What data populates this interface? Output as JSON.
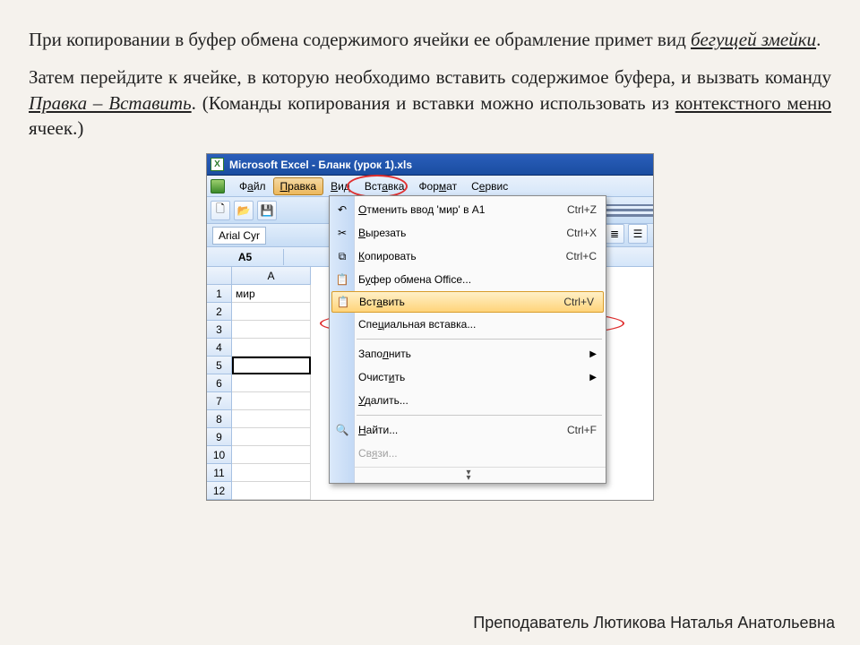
{
  "para1_head": "При копировании в буфер обмена содержимого ячейки ее обрамление примет вид ",
  "para1_u_i": "бегущей змейки",
  "para1_tail": ".",
  "para2_a": "Затем перейдите к ячейке, в которую необходимо вставить содержимое буфера, и вызвать команду ",
  "para2_i_u": "Правка – Вставить",
  "para2_b": ". (Команды копирования и вставки можно использовать из ",
  "para2_u2": "контекстного меню",
  "para2_c": " ячеек.)",
  "footer": "Преподаватель Лютикова Наталья Анатольевна",
  "excel": {
    "title": "Microsoft Excel - Бланк (урок 1).xls",
    "icon_letter": "X",
    "menus": {
      "file_pre": "Ф",
      "file_u": "а",
      "file_post": "йл",
      "edit_pre": "",
      "edit_u": "П",
      "edit_post": "равка",
      "view_pre": "",
      "view_u": "В",
      "view_post": "ид",
      "insert_pre": "Вст",
      "insert_u": "а",
      "insert_post": "вка",
      "format_pre": "Фор",
      "format_u": "м",
      "format_post": "ат",
      "service_pre": "С",
      "service_u": "е",
      "service_post": "рвис"
    },
    "font": "Arial Cyr",
    "namebox": "A5",
    "colA": "A",
    "cellA1": "мир",
    "rows": [
      "1",
      "2",
      "3",
      "4",
      "5",
      "6",
      "7",
      "8",
      "9",
      "10",
      "11",
      "12"
    ]
  },
  "dropdown": {
    "items": [
      {
        "icon": "↶",
        "label_pre": "",
        "label_u": "О",
        "label_post": "тменить ввод 'мир' в A1",
        "shortcut": "Ctrl+Z"
      },
      {
        "icon": "✂",
        "label_pre": "",
        "label_u": "В",
        "label_post": "ырезать",
        "shortcut": "Ctrl+X"
      },
      {
        "icon": "⧉",
        "label_pre": "",
        "label_u": "К",
        "label_post": "опировать",
        "shortcut": "Ctrl+C"
      },
      {
        "icon": "📋",
        "label_pre": "Б",
        "label_u": "у",
        "label_post": "фер обмена Office...",
        "shortcut": ""
      },
      {
        "icon": "📋",
        "label_pre": "Вст",
        "label_u": "а",
        "label_post": "вить",
        "shortcut": "Ctrl+V",
        "highlight": true
      },
      {
        "icon": "",
        "label_pre": "Спе",
        "label_u": "ц",
        "label_post": "иальная вставка...",
        "shortcut": ""
      },
      {
        "sep": true
      },
      {
        "icon": "",
        "label_pre": "Запо",
        "label_u": "л",
        "label_post": "нить",
        "arrow": true
      },
      {
        "icon": "",
        "label_pre": "Очист",
        "label_u": "и",
        "label_post": "ть",
        "arrow": true
      },
      {
        "icon": "",
        "label_pre": "",
        "label_u": "У",
        "label_post": "далить...",
        "shortcut": ""
      },
      {
        "sep": true
      },
      {
        "icon": "🔍",
        "label_pre": "",
        "label_u": "Н",
        "label_post": "айти...",
        "shortcut": "Ctrl+F"
      },
      {
        "icon": "",
        "label_pre": "Св",
        "label_u": "я",
        "label_post": "зи...",
        "disabled": true
      }
    ]
  }
}
